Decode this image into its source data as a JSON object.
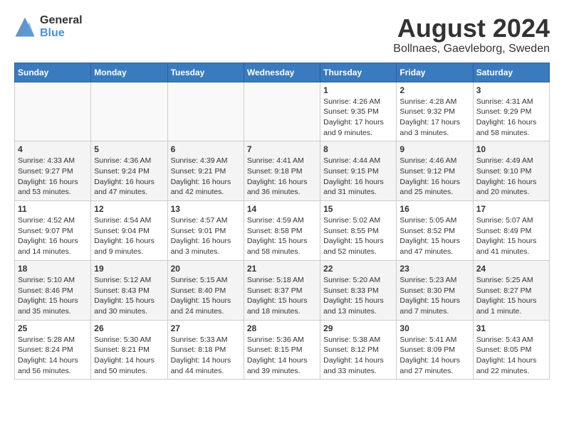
{
  "header": {
    "logo_line1": "General",
    "logo_line2": "Blue",
    "title": "August 2024",
    "subtitle": "Bollnaes, Gaevleborg, Sweden"
  },
  "days_of_week": [
    "Sunday",
    "Monday",
    "Tuesday",
    "Wednesday",
    "Thursday",
    "Friday",
    "Saturday"
  ],
  "weeks": [
    [
      {
        "day": "",
        "info": ""
      },
      {
        "day": "",
        "info": ""
      },
      {
        "day": "",
        "info": ""
      },
      {
        "day": "",
        "info": ""
      },
      {
        "day": "1",
        "info": "Sunrise: 4:26 AM\nSunset: 9:35 PM\nDaylight: 17 hours\nand 9 minutes."
      },
      {
        "day": "2",
        "info": "Sunrise: 4:28 AM\nSunset: 9:32 PM\nDaylight: 17 hours\nand 3 minutes."
      },
      {
        "day": "3",
        "info": "Sunrise: 4:31 AM\nSunset: 9:29 PM\nDaylight: 16 hours\nand 58 minutes."
      }
    ],
    [
      {
        "day": "4",
        "info": "Sunrise: 4:33 AM\nSunset: 9:27 PM\nDaylight: 16 hours\nand 53 minutes."
      },
      {
        "day": "5",
        "info": "Sunrise: 4:36 AM\nSunset: 9:24 PM\nDaylight: 16 hours\nand 47 minutes."
      },
      {
        "day": "6",
        "info": "Sunrise: 4:39 AM\nSunset: 9:21 PM\nDaylight: 16 hours\nand 42 minutes."
      },
      {
        "day": "7",
        "info": "Sunrise: 4:41 AM\nSunset: 9:18 PM\nDaylight: 16 hours\nand 36 minutes."
      },
      {
        "day": "8",
        "info": "Sunrise: 4:44 AM\nSunset: 9:15 PM\nDaylight: 16 hours\nand 31 minutes."
      },
      {
        "day": "9",
        "info": "Sunrise: 4:46 AM\nSunset: 9:12 PM\nDaylight: 16 hours\nand 25 minutes."
      },
      {
        "day": "10",
        "info": "Sunrise: 4:49 AM\nSunset: 9:10 PM\nDaylight: 16 hours\nand 20 minutes."
      }
    ],
    [
      {
        "day": "11",
        "info": "Sunrise: 4:52 AM\nSunset: 9:07 PM\nDaylight: 16 hours\nand 14 minutes."
      },
      {
        "day": "12",
        "info": "Sunrise: 4:54 AM\nSunset: 9:04 PM\nDaylight: 16 hours\nand 9 minutes."
      },
      {
        "day": "13",
        "info": "Sunrise: 4:57 AM\nSunset: 9:01 PM\nDaylight: 16 hours\nand 3 minutes."
      },
      {
        "day": "14",
        "info": "Sunrise: 4:59 AM\nSunset: 8:58 PM\nDaylight: 15 hours\nand 58 minutes."
      },
      {
        "day": "15",
        "info": "Sunrise: 5:02 AM\nSunset: 8:55 PM\nDaylight: 15 hours\nand 52 minutes."
      },
      {
        "day": "16",
        "info": "Sunrise: 5:05 AM\nSunset: 8:52 PM\nDaylight: 15 hours\nand 47 minutes."
      },
      {
        "day": "17",
        "info": "Sunrise: 5:07 AM\nSunset: 8:49 PM\nDaylight: 15 hours\nand 41 minutes."
      }
    ],
    [
      {
        "day": "18",
        "info": "Sunrise: 5:10 AM\nSunset: 8:46 PM\nDaylight: 15 hours\nand 35 minutes."
      },
      {
        "day": "19",
        "info": "Sunrise: 5:12 AM\nSunset: 8:43 PM\nDaylight: 15 hours\nand 30 minutes."
      },
      {
        "day": "20",
        "info": "Sunrise: 5:15 AM\nSunset: 8:40 PM\nDaylight: 15 hours\nand 24 minutes."
      },
      {
        "day": "21",
        "info": "Sunrise: 5:18 AM\nSunset: 8:37 PM\nDaylight: 15 hours\nand 18 minutes."
      },
      {
        "day": "22",
        "info": "Sunrise: 5:20 AM\nSunset: 8:33 PM\nDaylight: 15 hours\nand 13 minutes."
      },
      {
        "day": "23",
        "info": "Sunrise: 5:23 AM\nSunset: 8:30 PM\nDaylight: 15 hours\nand 7 minutes."
      },
      {
        "day": "24",
        "info": "Sunrise: 5:25 AM\nSunset: 8:27 PM\nDaylight: 15 hours\nand 1 minute."
      }
    ],
    [
      {
        "day": "25",
        "info": "Sunrise: 5:28 AM\nSunset: 8:24 PM\nDaylight: 14 hours\nand 56 minutes."
      },
      {
        "day": "26",
        "info": "Sunrise: 5:30 AM\nSunset: 8:21 PM\nDaylight: 14 hours\nand 50 minutes."
      },
      {
        "day": "27",
        "info": "Sunrise: 5:33 AM\nSunset: 8:18 PM\nDaylight: 14 hours\nand 44 minutes."
      },
      {
        "day": "28",
        "info": "Sunrise: 5:36 AM\nSunset: 8:15 PM\nDaylight: 14 hours\nand 39 minutes."
      },
      {
        "day": "29",
        "info": "Sunrise: 5:38 AM\nSunset: 8:12 PM\nDaylight: 14 hours\nand 33 minutes."
      },
      {
        "day": "30",
        "info": "Sunrise: 5:41 AM\nSunset: 8:09 PM\nDaylight: 14 hours\nand 27 minutes."
      },
      {
        "day": "31",
        "info": "Sunrise: 5:43 AM\nSunset: 8:05 PM\nDaylight: 14 hours\nand 22 minutes."
      }
    ]
  ]
}
